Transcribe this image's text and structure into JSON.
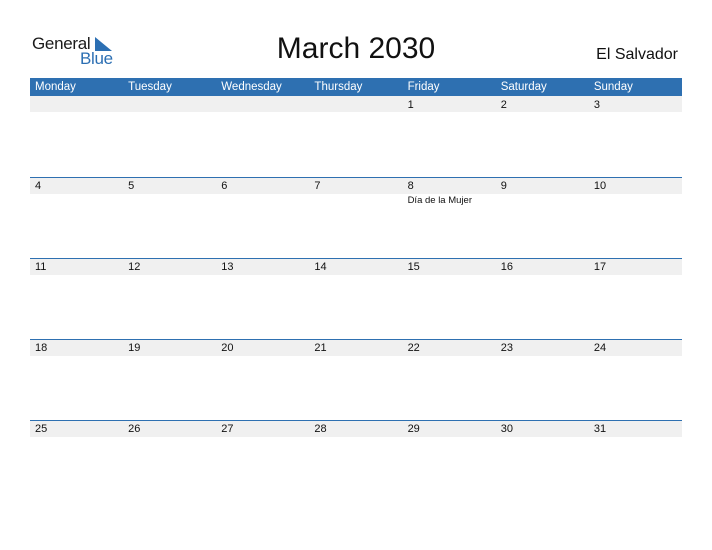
{
  "logo": {
    "line1": "General",
    "line2": "Blue"
  },
  "title": "March 2030",
  "country": "El Salvador",
  "colors": {
    "accent": "#2e70b1",
    "band": "#f0f0f0"
  },
  "weekdays": [
    "Monday",
    "Tuesday",
    "Wednesday",
    "Thursday",
    "Friday",
    "Saturday",
    "Sunday"
  ],
  "weeks": [
    {
      "days": [
        {
          "num": "",
          "event": ""
        },
        {
          "num": "",
          "event": ""
        },
        {
          "num": "",
          "event": ""
        },
        {
          "num": "",
          "event": ""
        },
        {
          "num": "1",
          "event": ""
        },
        {
          "num": "2",
          "event": ""
        },
        {
          "num": "3",
          "event": ""
        }
      ]
    },
    {
      "days": [
        {
          "num": "4",
          "event": ""
        },
        {
          "num": "5",
          "event": ""
        },
        {
          "num": "6",
          "event": ""
        },
        {
          "num": "7",
          "event": ""
        },
        {
          "num": "8",
          "event": "Día de la Mujer"
        },
        {
          "num": "9",
          "event": ""
        },
        {
          "num": "10",
          "event": ""
        }
      ]
    },
    {
      "days": [
        {
          "num": "11",
          "event": ""
        },
        {
          "num": "12",
          "event": ""
        },
        {
          "num": "13",
          "event": ""
        },
        {
          "num": "14",
          "event": ""
        },
        {
          "num": "15",
          "event": ""
        },
        {
          "num": "16",
          "event": ""
        },
        {
          "num": "17",
          "event": ""
        }
      ]
    },
    {
      "days": [
        {
          "num": "18",
          "event": ""
        },
        {
          "num": "19",
          "event": ""
        },
        {
          "num": "20",
          "event": ""
        },
        {
          "num": "21",
          "event": ""
        },
        {
          "num": "22",
          "event": ""
        },
        {
          "num": "23",
          "event": ""
        },
        {
          "num": "24",
          "event": ""
        }
      ]
    },
    {
      "days": [
        {
          "num": "25",
          "event": ""
        },
        {
          "num": "26",
          "event": ""
        },
        {
          "num": "27",
          "event": ""
        },
        {
          "num": "28",
          "event": ""
        },
        {
          "num": "29",
          "event": ""
        },
        {
          "num": "30",
          "event": ""
        },
        {
          "num": "31",
          "event": ""
        }
      ]
    }
  ]
}
